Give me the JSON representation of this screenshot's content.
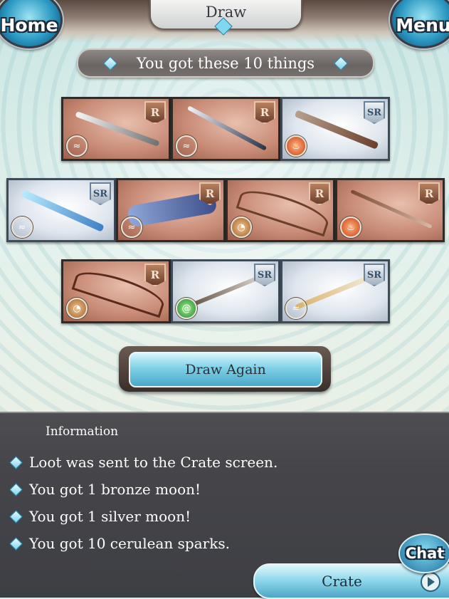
{
  "header": {
    "title": "Draw",
    "home_label": "Home",
    "menu_label": "Menu"
  },
  "subtitle": "You got these 10 things",
  "results": [
    {
      "rarity": "R",
      "element": "water",
      "weapon": "curved-blade"
    },
    {
      "rarity": "R",
      "element": "water",
      "weapon": "staff"
    },
    {
      "rarity": "SR",
      "element": "fire",
      "weapon": "gun"
    },
    {
      "rarity": "SR",
      "element": "water",
      "weapon": "sword"
    },
    {
      "rarity": "R",
      "element": "water",
      "weapon": "crystal-axe"
    },
    {
      "rarity": "R",
      "element": "earth",
      "weapon": "bow"
    },
    {
      "rarity": "R",
      "element": "fire",
      "weapon": "spear"
    },
    {
      "rarity": "R",
      "element": "earth",
      "weapon": "bow"
    },
    {
      "rarity": "SR",
      "element": "wind",
      "weapon": "dagger"
    },
    {
      "rarity": "SR",
      "element": "water",
      "weapon": "sword"
    }
  ],
  "draw_again_label": "Draw Again",
  "info": {
    "heading": "Information",
    "lines": [
      "Loot was sent to the Crate screen.",
      "You got 1 bronze moon!",
      "You got 1 silver moon!",
      "You got 10 cerulean sparks."
    ]
  },
  "chat_label": "Chat",
  "crate_label": "Crate"
}
